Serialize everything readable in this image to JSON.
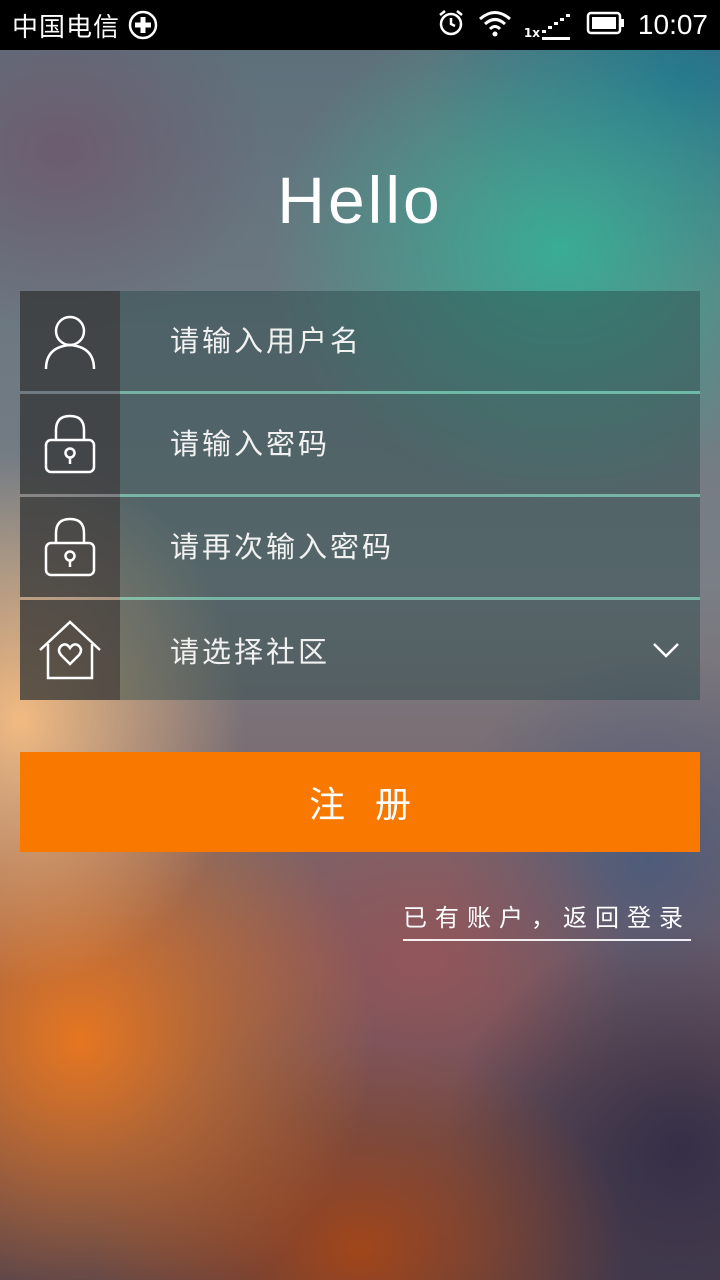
{
  "status_bar": {
    "carrier": "中国电信",
    "time": "10:07",
    "network_label": "1x",
    "icons": [
      "plus-badge-icon",
      "alarm-icon",
      "wifi-icon",
      "signal-icon",
      "battery-icon"
    ]
  },
  "title": "Hello",
  "form": {
    "username": {
      "placeholder": "请输入用户名",
      "icon": "user-icon"
    },
    "password": {
      "placeholder": "请输入密码",
      "icon": "lock-icon"
    },
    "password_confirm": {
      "placeholder": "请再次输入密码",
      "icon": "lock-icon"
    },
    "community": {
      "label": "请选择社区",
      "icon": "home-heart-icon",
      "dropdown_icon": "chevron-down-icon"
    }
  },
  "register_button": {
    "label": "注册",
    "color": "#f97800"
  },
  "login_link": {
    "label": "已有账户，返回登录"
  }
}
